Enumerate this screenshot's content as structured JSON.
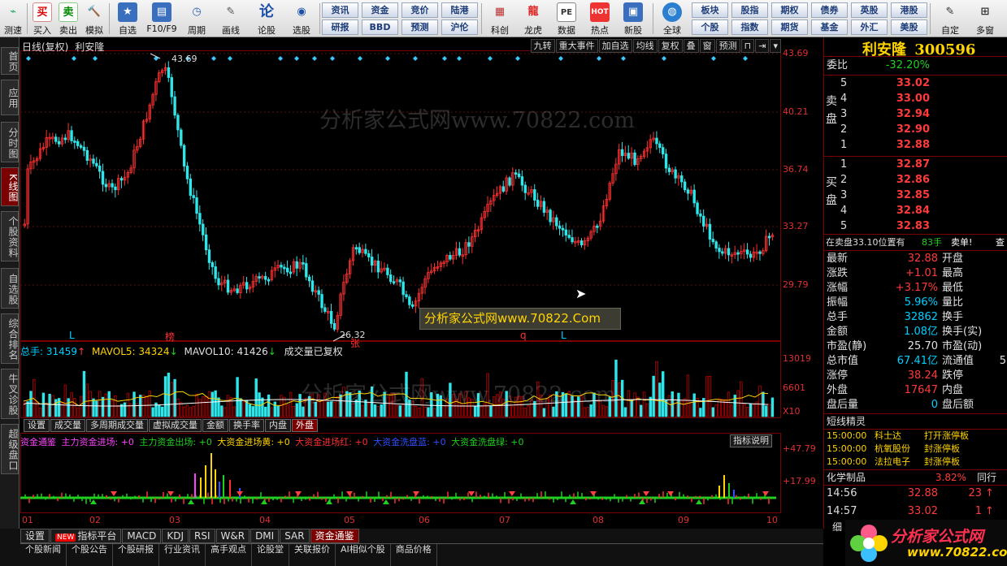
{
  "toolbar": {
    "items": [
      {
        "label": "测速",
        "icon": "speed-test-icon"
      },
      {
        "label": "买入",
        "icon": "buy-icon",
        "glyph": "买"
      },
      {
        "label": "卖出",
        "icon": "sell-icon",
        "glyph": "卖"
      },
      {
        "label": "模拟",
        "icon": "hammer-icon"
      },
      {
        "label": "自选",
        "icon": "star-icon"
      },
      {
        "label": "F10/F9",
        "icon": "f10-icon"
      },
      {
        "label": "周期",
        "icon": "clock-icon"
      },
      {
        "label": "画线",
        "icon": "pencil-icon"
      },
      {
        "label": "论股",
        "icon": "discuss-icon",
        "glyph": "论"
      },
      {
        "label": "选股",
        "icon": "stock-picker-icon"
      }
    ],
    "grid": [
      [
        "资讯",
        "资金",
        "竞价",
        "陆港"
      ],
      [
        "研报",
        "BBD",
        "预测",
        "沪伦"
      ]
    ],
    "items2": [
      {
        "label": "科创",
        "icon": "science-board-icon"
      },
      {
        "label": "龙虎",
        "icon": "dragon-tiger-icon"
      },
      {
        "label": "数据",
        "icon": "data-icon",
        "glyph": "PE"
      },
      {
        "label": "热点",
        "icon": "hot-icon",
        "glyph": "HOT"
      },
      {
        "label": "新股",
        "icon": "new-stock-icon"
      },
      {
        "label": "全球",
        "icon": "globe-icon"
      }
    ],
    "grid2": [
      [
        "板块",
        "股指",
        "期权",
        "债券",
        "英股",
        "港股"
      ],
      [
        "个股",
        "指数",
        "期货",
        "基金",
        "外汇",
        "美股"
      ]
    ],
    "items3": [
      {
        "label": "自定",
        "icon": "customize-icon"
      },
      {
        "label": "多窗",
        "icon": "multi-window-icon"
      }
    ]
  },
  "left_tabs": [
    "首页",
    "应用",
    "分时图",
    "K线图",
    "个股资料",
    "自选股",
    "综合排名",
    "牛叉诊股",
    "超级盘口"
  ],
  "left_tab_active": "K线图",
  "kline": {
    "title": "日线(复权)",
    "stock": "利安隆",
    "top_buttons": [
      "九转",
      "重大事件",
      "加自选",
      "均线",
      "复权",
      "叠",
      "窗",
      "预测"
    ],
    "price_axis": [
      "43.69",
      "40.21",
      "36.74",
      "33.27",
      "29.79"
    ],
    "high_label": "43.69",
    "low_label": "26.32",
    "markers": [
      "L",
      "榜",
      "张",
      "q",
      "L"
    ],
    "watermark": "分析家公式网www.70822.com",
    "tooltip": "分析家公式网www.70822.Com"
  },
  "volume": {
    "total_label": "总手:",
    "total_value": "31459",
    "ma5_label": "MAVOL5:",
    "ma5_value": "34324",
    "ma10_label": "MAVOL10:",
    "ma10_value": "41426",
    "note": "成交量已复权",
    "axis": [
      "13019",
      "6601",
      "X10"
    ],
    "tabs": [
      "设置",
      "成交量",
      "多周期成交量",
      "虚拟成交量",
      "金额",
      "换手率",
      "内盘",
      "外盘"
    ],
    "active_tab": "外盘",
    "watermark": "分析家公式网www.70822.com"
  },
  "indicator": {
    "name": "资金通鉴",
    "legend": [
      {
        "text": "主力资金进场: +0",
        "color": "#ff40ff"
      },
      {
        "text": "主力资金出场: +0",
        "color": "#20d020"
      },
      {
        "text": "大资金进场黄: +0",
        "color": "#ffd400"
      },
      {
        "text": "大资金进场红: +0",
        "color": "#ff3030"
      },
      {
        "text": "大资金洗盘蓝: +0",
        "color": "#3050ff"
      },
      {
        "text": "大资金洗盘绿: +0",
        "color": "#20d020"
      }
    ],
    "help_button": "指标说明",
    "axis": [
      "+47.79",
      "+17.99"
    ],
    "months": [
      "01",
      "02",
      "03",
      "04",
      "05",
      "06",
      "07",
      "08",
      "09",
      "10"
    ]
  },
  "bottom_tabs": [
    "设置",
    "指标平台",
    "MACD",
    "KDJ",
    "RSI",
    "W&R",
    "DMI",
    "SAR",
    "资金通鉴"
  ],
  "bottom_active": "资金通鉴",
  "bottom_new_badge": "NEW",
  "bottom_links": [
    "个股新闻",
    "个股公告",
    "个股研报",
    "行业资讯",
    "高手观点",
    "论股堂",
    "关联报价",
    "AI相似个股",
    "商品价格"
  ],
  "quote": {
    "name": "利安隆",
    "code": "300596",
    "weibi_label": "委比",
    "weibi": "-32.20%",
    "sell_label": "卖盘",
    "buy_label": "买盘",
    "asks": [
      {
        "level": "5",
        "price": "33.02"
      },
      {
        "level": "4",
        "price": "33.00"
      },
      {
        "level": "3",
        "price": "32.94"
      },
      {
        "level": "2",
        "price": "32.90"
      },
      {
        "level": "1",
        "price": "32.88"
      }
    ],
    "bids": [
      {
        "level": "1",
        "price": "32.87"
      },
      {
        "level": "2",
        "price": "32.86"
      },
      {
        "level": "3",
        "price": "32.85"
      },
      {
        "level": "4",
        "price": "32.84"
      },
      {
        "level": "5",
        "price": "32.83"
      }
    ],
    "pending_text": "在卖盘33.10位置有",
    "pending_qty": "83手",
    "pending_tag": "卖单!",
    "pending_extra": "查",
    "stats": [
      {
        "l1": "最新",
        "v1": "32.88",
        "c1": "red",
        "l2": "开盘",
        "v2": ""
      },
      {
        "l1": "涨跌",
        "v1": "+1.01",
        "c1": "red",
        "l2": "最高",
        "v2": ""
      },
      {
        "l1": "涨幅",
        "v1": "+3.17%",
        "c1": "red",
        "l2": "最低",
        "v2": ""
      },
      {
        "l1": "振幅",
        "v1": "5.96%",
        "c1": "cyan",
        "l2": "量比",
        "v2": ""
      },
      {
        "l1": "总手",
        "v1": "32862",
        "c1": "cyan",
        "l2": "换手",
        "v2": ""
      },
      {
        "l1": "金额",
        "v1": "1.08亿",
        "c1": "cyan",
        "l2": "换手(实)",
        "v2": ""
      },
      {
        "l1": "市盈(静)",
        "v1": "25.70",
        "c1": "white",
        "l2": "市盈(动)",
        "v2": ""
      },
      {
        "l1": "总市值",
        "v1": "67.41亿",
        "c1": "cyan",
        "l2": "流通值",
        "v2": "5"
      },
      {
        "l1": "涨停",
        "v1": "38.24",
        "c1": "red",
        "l2": "跌停",
        "v2": ""
      },
      {
        "l1": "外盘",
        "v1": "17647",
        "c1": "red",
        "l2": "内盘",
        "v2": ""
      },
      {
        "l1": "盘后量",
        "v1": "0",
        "c1": "cyan",
        "l2": "盘后额",
        "v2": ""
      }
    ],
    "short_title": "短线精灵",
    "short_items": [
      {
        "time": "15:00:00",
        "name": "科士达",
        "event": "打开涨停板"
      },
      {
        "time": "15:00:00",
        "name": "杭氧股份",
        "event": "封涨停板"
      },
      {
        "time": "15:00:00",
        "name": "法拉电子",
        "event": "封涨停板"
      }
    ],
    "sector": "化学制品",
    "sector_pct": "3.82%",
    "sector_link": "同行",
    "ticks": [
      {
        "time": "14:56",
        "price": "32.88",
        "qty": "23",
        "dir": "↑"
      },
      {
        "time": "14:57",
        "price": "33.02",
        "qty": "1",
        "dir": "↑"
      }
    ],
    "tick_tail": "细"
  },
  "logo": {
    "text": "分析家公式网",
    "url": "www.70822.com"
  }
}
